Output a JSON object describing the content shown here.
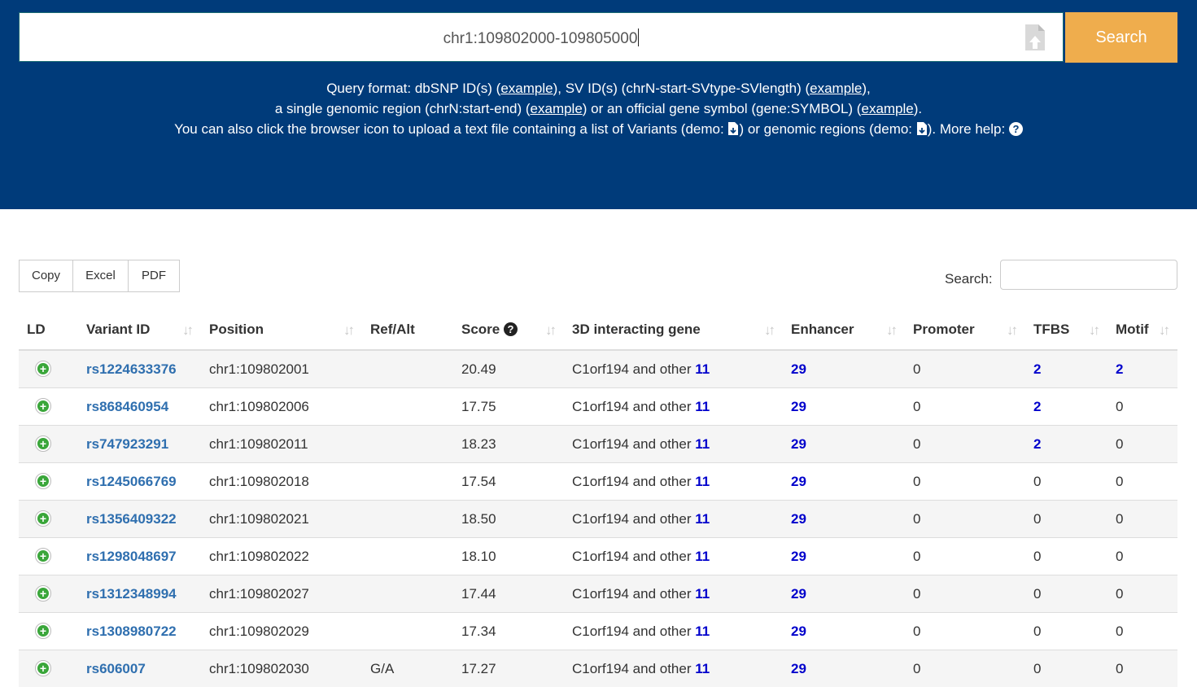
{
  "search": {
    "query_value": "chr1:109802000-109805000",
    "button_label": "Search"
  },
  "help": {
    "line1_a": "Query format: dbSNP ID(s) (",
    "line1_link1": "example",
    "line1_b": "), SV ID(s) (chrN-start-SVtype-SVlength) (",
    "line1_link2": "example",
    "line1_c": "),",
    "line2_a": "a single genomic region (chrN:start-end) (",
    "line2_link1": "example",
    "line2_b": ") or an official gene symbol (gene:SYMBOL) (",
    "line2_link2": "example",
    "line2_c": ").",
    "line3_a": "You can also click the browser icon to upload a text file containing a list of Variants (demo: ",
    "line3_b": ") or genomic regions (demo: ",
    "line3_c": "). More help: "
  },
  "export": {
    "copy": "Copy",
    "excel": "Excel",
    "pdf": "PDF"
  },
  "table_search": {
    "label": "Search:"
  },
  "columns": {
    "ld": "LD",
    "variant": "Variant ID",
    "position": "Position",
    "refalt": "Ref/Alt",
    "score": "Score",
    "gene": "3D interacting gene",
    "enhancer": "Enhancer",
    "promoter": "Promoter",
    "tfbs": "TFBS",
    "motif": "Motif"
  },
  "rows": [
    {
      "variant": "rs1224633376",
      "position": "chr1:109802001",
      "refalt": "",
      "score": "20.49",
      "gene_text": "C1orf194 and other ",
      "gene_count": "11",
      "enhancer": "29",
      "promoter": "0",
      "tfbs": "2",
      "motif": "2"
    },
    {
      "variant": "rs868460954",
      "position": "chr1:109802006",
      "refalt": "",
      "score": "17.75",
      "gene_text": "C1orf194 and other ",
      "gene_count": "11",
      "enhancer": "29",
      "promoter": "0",
      "tfbs": "2",
      "motif": "0"
    },
    {
      "variant": "rs747923291",
      "position": "chr1:109802011",
      "refalt": "",
      "score": "18.23",
      "gene_text": "C1orf194 and other ",
      "gene_count": "11",
      "enhancer": "29",
      "promoter": "0",
      "tfbs": "2",
      "motif": "0"
    },
    {
      "variant": "rs1245066769",
      "position": "chr1:109802018",
      "refalt": "",
      "score": "17.54",
      "gene_text": "C1orf194 and other ",
      "gene_count": "11",
      "enhancer": "29",
      "promoter": "0",
      "tfbs": "0",
      "motif": "0"
    },
    {
      "variant": "rs1356409322",
      "position": "chr1:109802021",
      "refalt": "",
      "score": "18.50",
      "gene_text": "C1orf194 and other ",
      "gene_count": "11",
      "enhancer": "29",
      "promoter": "0",
      "tfbs": "0",
      "motif": "0"
    },
    {
      "variant": "rs1298048697",
      "position": "chr1:109802022",
      "refalt": "",
      "score": "18.10",
      "gene_text": "C1orf194 and other ",
      "gene_count": "11",
      "enhancer": "29",
      "promoter": "0",
      "tfbs": "0",
      "motif": "0"
    },
    {
      "variant": "rs1312348994",
      "position": "chr1:109802027",
      "refalt": "",
      "score": "17.44",
      "gene_text": "C1orf194 and other ",
      "gene_count": "11",
      "enhancer": "29",
      "promoter": "0",
      "tfbs": "0",
      "motif": "0"
    },
    {
      "variant": "rs1308980722",
      "position": "chr1:109802029",
      "refalt": "",
      "score": "17.34",
      "gene_text": "C1orf194 and other ",
      "gene_count": "11",
      "enhancer": "29",
      "promoter": "0",
      "tfbs": "0",
      "motif": "0"
    },
    {
      "variant": "rs606007",
      "position": "chr1:109802030",
      "refalt": "G/A",
      "score": "17.27",
      "gene_text": "C1orf194 and other ",
      "gene_count": "11",
      "enhancer": "29",
      "promoter": "0",
      "tfbs": "0",
      "motif": "0"
    }
  ]
}
